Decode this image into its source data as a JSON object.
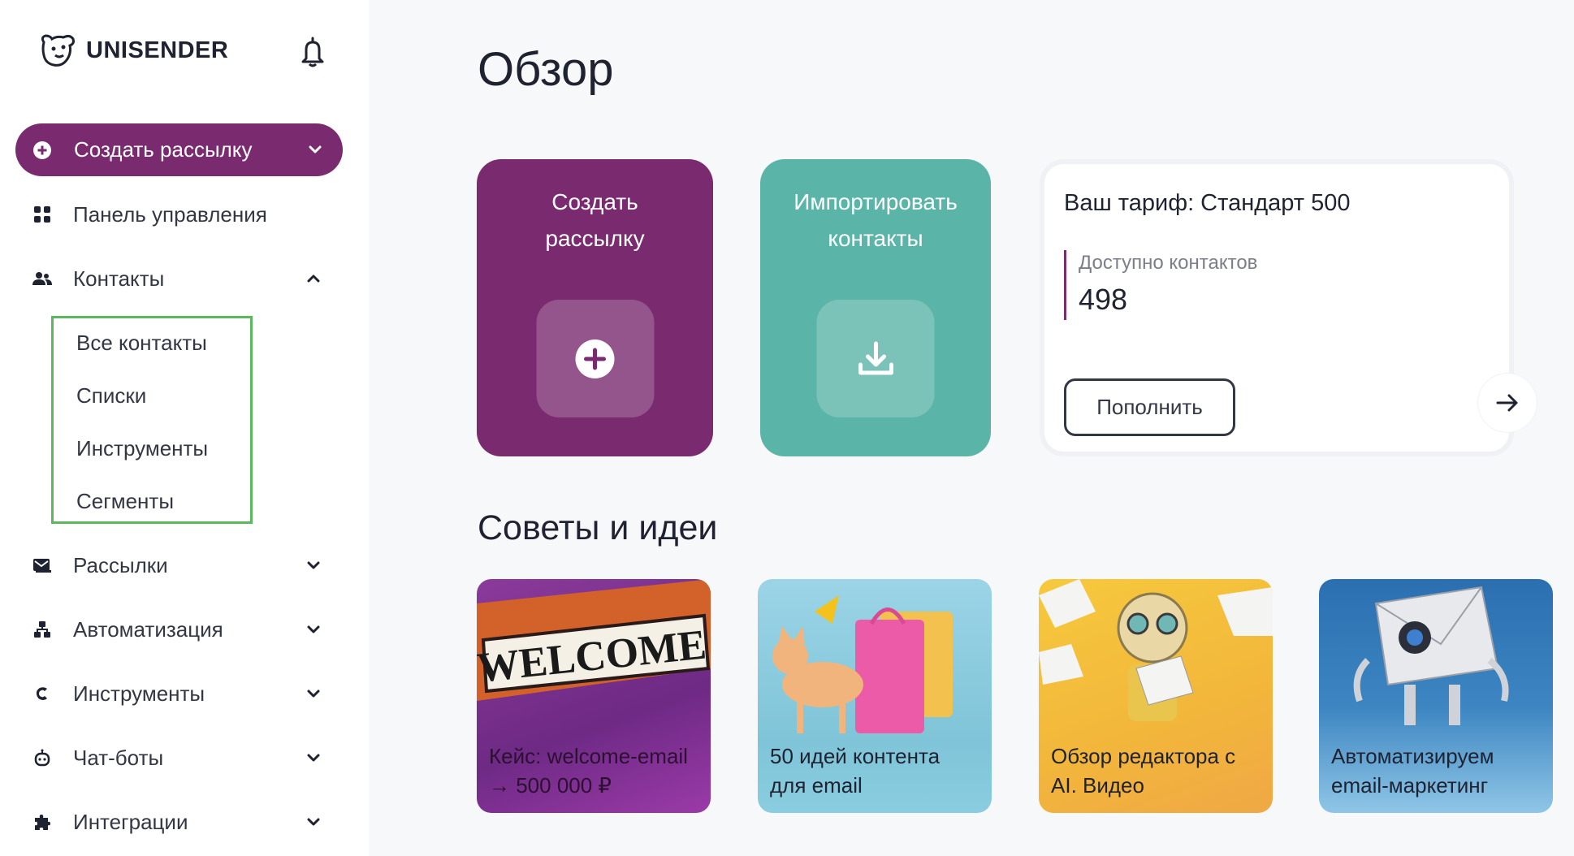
{
  "sidebar": {
    "logo_text": "UNISENDER",
    "create_button": "Создать рассылку",
    "items": [
      {
        "label": "Панель управления",
        "icon": "grid-icon"
      },
      {
        "label": "Контакты",
        "icon": "users-icon"
      },
      {
        "label": "Рассылки",
        "icon": "mail-icon"
      },
      {
        "label": "Автоматизация",
        "icon": "automation-icon"
      },
      {
        "label": "Инструменты",
        "icon": "tools-icon"
      },
      {
        "label": "Чат-боты",
        "icon": "bot-icon"
      },
      {
        "label": "Интеграции",
        "icon": "puzzle-icon"
      }
    ],
    "contacts_sub": [
      "Все контакты",
      "Списки",
      "Инструменты",
      "Сегменты"
    ]
  },
  "main": {
    "title": "Обзор",
    "create_card": {
      "line1": "Создать",
      "line2": "рассылку"
    },
    "import_card": {
      "line1": "Импортировать",
      "line2": "контакты"
    },
    "tariff": {
      "title": "Ваш тариф: Стандарт 500",
      "available_label": "Доступно контактов",
      "available_value": "498",
      "topup_button": "Пополнить"
    },
    "tips_title": "Советы и идеи",
    "tips": [
      {
        "line1": "Кейс: welcome-email",
        "line2": "→ 500 000 ₽",
        "image_text": "WELCOME"
      },
      {
        "line1": "50 идей контента",
        "line2": "для email"
      },
      {
        "line1": "Обзор редактора с",
        "line2": "AI. Видео"
      },
      {
        "line1": "Автоматизируем",
        "line2": "email-маркетинг"
      }
    ]
  },
  "colors": {
    "brand": "#7a2b70",
    "teal": "#5ab5a8",
    "highlight": "#5cb85c"
  }
}
